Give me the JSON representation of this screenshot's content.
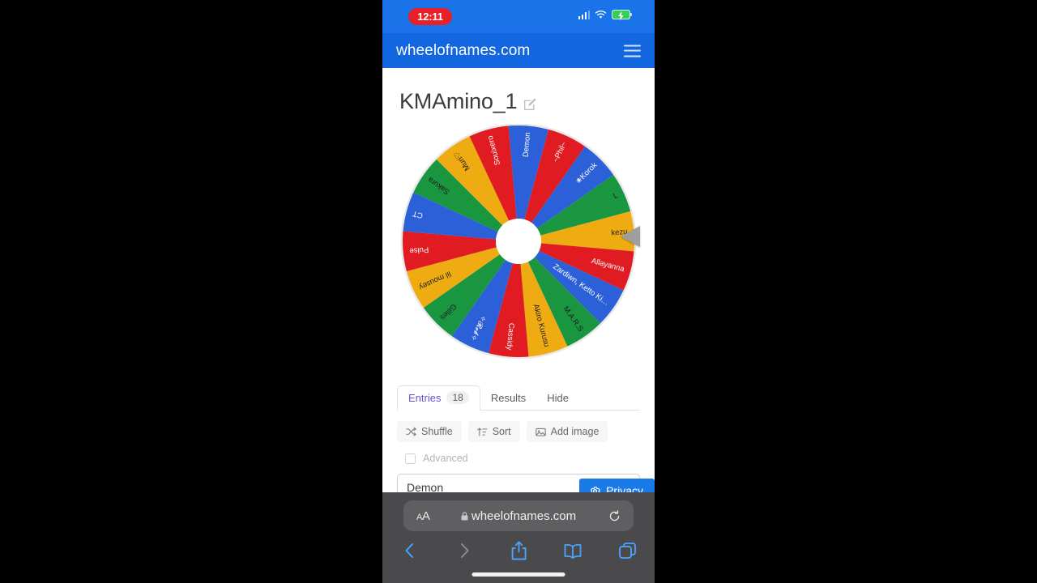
{
  "status_bar": {
    "time": "12:11",
    "icons": [
      "cellular-signal-icon",
      "wifi-icon",
      "battery-charging-icon"
    ]
  },
  "site_header": {
    "title": "wheelofnames.com",
    "menu_icon": "hamburger-menu-icon",
    "background": "#1266e0"
  },
  "page": {
    "title": "KMAmino_1",
    "edit_icon": "edit-pencil-icon"
  },
  "wheel": {
    "pointer_icon": "wheel-pointer-triangle",
    "colors": [
      "#e01b22",
      "#2b60d8",
      "#1a9641",
      "#eeab12"
    ],
    "segments": [
      {
        "label": "Demon",
        "color": "#2b60d8"
      },
      {
        "label": "~Phil~",
        "color": "#e01b22"
      },
      {
        "label": "✬Korok",
        "color": "#2b60d8"
      },
      {
        "label": "L",
        "color": "#1a9641"
      },
      {
        "label": "kezu",
        "color": "#eeab12"
      },
      {
        "label": "Allayanna",
        "color": "#e01b22"
      },
      {
        "label": "Zardiwn, Ketto Ki…",
        "color": "#2b60d8"
      },
      {
        "label": "M.A.R.S",
        "color": "#1a9641"
      },
      {
        "label": "Akiro Kurusu",
        "color": "#eeab12"
      },
      {
        "label": "Cassidy",
        "color": "#e01b22"
      },
      {
        "label": "✧𝓡𝓮𝓫✧",
        "color": "#2b60d8"
      },
      {
        "label": "Gilles",
        "color": "#1a9641"
      },
      {
        "label": "lil mousey",
        "color": "#eeab12"
      },
      {
        "label": "Pulse",
        "color": "#e01b22"
      },
      {
        "label": "CT",
        "color": "#2b60d8"
      },
      {
        "label": "Sakura",
        "color": "#1a9641"
      },
      {
        "label": "Muri♡",
        "color": "#eeab12"
      },
      {
        "label": "Souixero",
        "color": "#e01b22"
      }
    ]
  },
  "tabs": [
    {
      "label": "Entries",
      "count": "18",
      "active": true
    },
    {
      "label": "Results",
      "count": "",
      "active": false
    },
    {
      "label": "Hide",
      "count": "",
      "active": false
    }
  ],
  "toolbar": [
    {
      "label": "Shuffle",
      "icon": "shuffle-icon"
    },
    {
      "label": "Sort",
      "icon": "sort-icon"
    },
    {
      "label": "Add image",
      "icon": "image-icon"
    }
  ],
  "advanced": {
    "label": "Advanced",
    "checked": false
  },
  "entries_input": {
    "value": "Demon"
  },
  "privacy_button": {
    "label": "Privacy",
    "icon": "gear-icon",
    "color": "#1a7ae8"
  },
  "safari": {
    "text_size_label": "AA",
    "url": "wheelofnames.com",
    "lock_icon": "lock-icon",
    "reload_icon": "reload-icon",
    "nav_icons": [
      "back-icon",
      "forward-icon",
      "share-icon",
      "bookmarks-icon",
      "tabs-icon"
    ]
  }
}
